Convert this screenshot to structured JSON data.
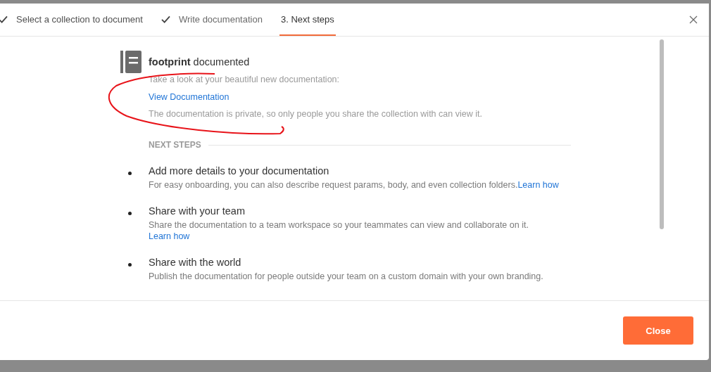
{
  "tabs": [
    {
      "label": "Select a collection to document",
      "completed": true,
      "selected": false
    },
    {
      "label": "Write documentation",
      "completed": true,
      "selected": false
    },
    {
      "label": "3. Next steps",
      "completed": false,
      "selected": true
    }
  ],
  "summary": {
    "title": "**footprint** documented",
    "intro": "Take a look at your beautiful new documentation:",
    "link": "View Documentation",
    "note": "The documentation is private, so only people you share the collection with can view it."
  },
  "next_steps": {
    "heading": "NEXT STEPS",
    "items": [
      {
        "title": "Add more details to your documentation",
        "text": "For easy onboarding, you can also describe request params, body, and even collection folders.",
        "link": "Learn how",
        "link_inline": true
      },
      {
        "title": "Share with your team",
        "text": "Share the documentation to a team workspace so your teammates can view and collaborate on it.",
        "link": "Learn how",
        "link_inline": false
      },
      {
        "title": "Share with the world",
        "text": "Publish the documentation for people outside your team on a custom domain with your own branding."
      }
    ]
  },
  "footer": {
    "button": "Close"
  }
}
